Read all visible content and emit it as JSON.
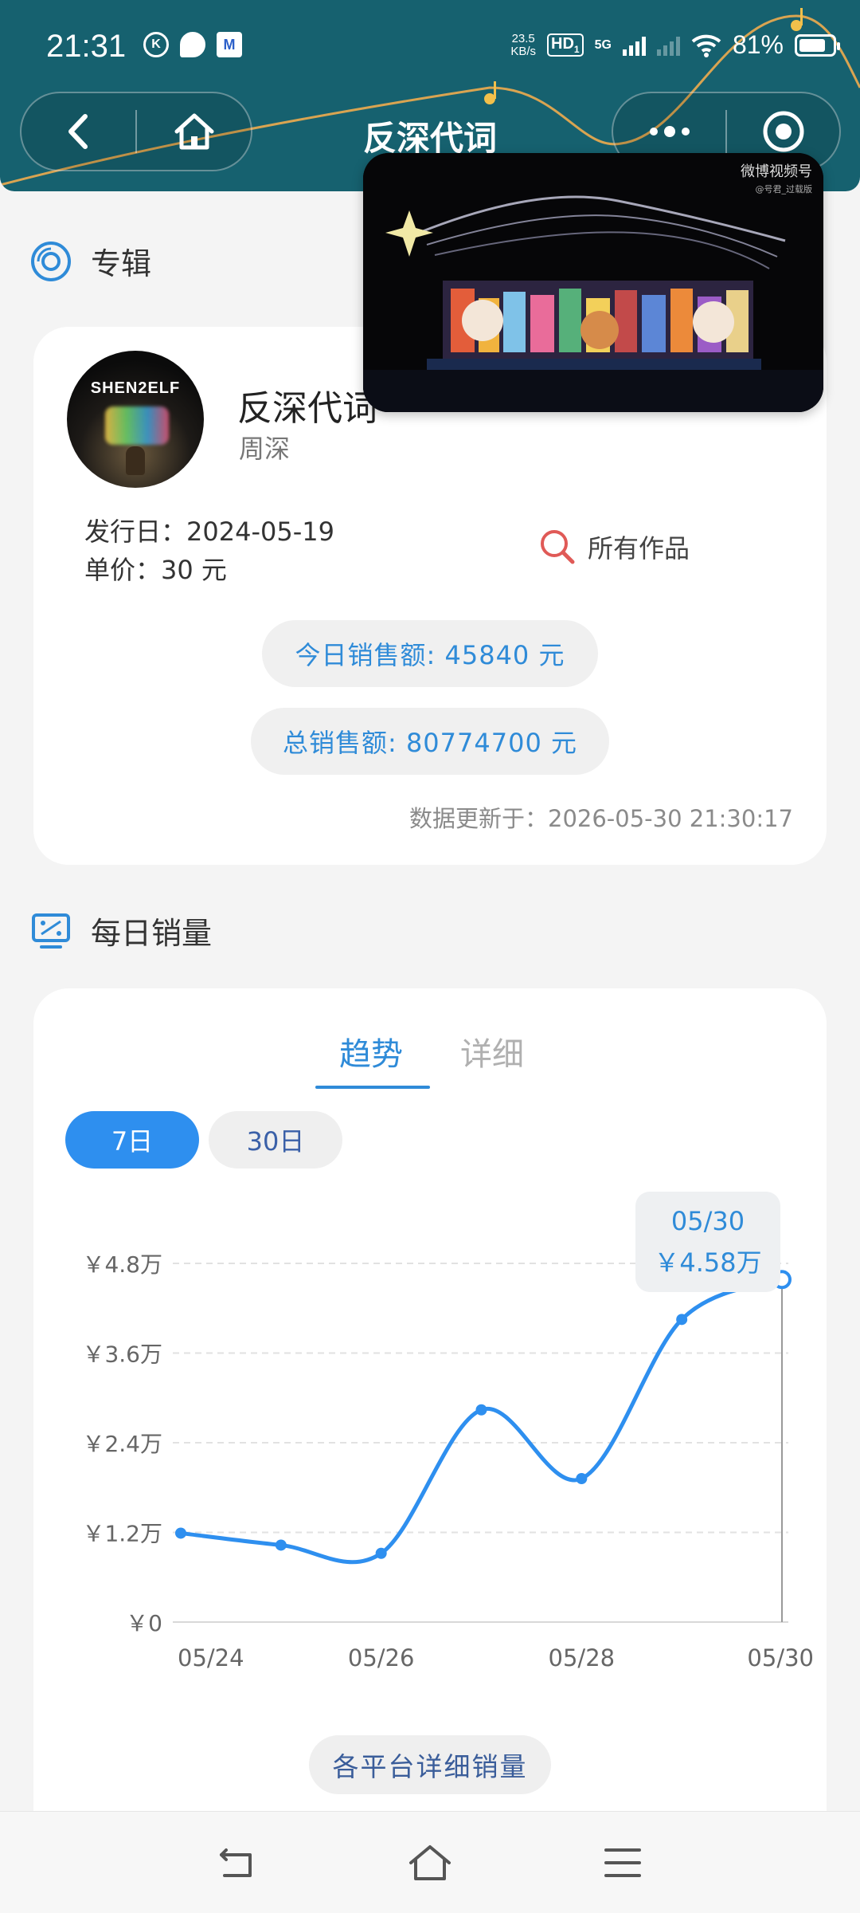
{
  "status_bar": {
    "time": "21:31",
    "net_speed_value": "23.5",
    "net_speed_unit": "KB/s",
    "hd_label": "HD",
    "hd_sub": "1",
    "network": "5G",
    "battery_percent": "81%",
    "battery_level": 0.81
  },
  "header": {
    "title": "反深代词"
  },
  "album_section": {
    "label": "专辑",
    "cover_text": "SHEN2ELF",
    "album_title": "反深代词",
    "artist": "周深",
    "release": "发行日：2024-05-19",
    "price": "单价：30 元",
    "all_works": "所有作品",
    "today_sales": "今日销售额: 45840 元",
    "total_sales": "总销售额: 80774700 元",
    "updated": "数据更新于：2026-05-30 21:30:17"
  },
  "video": {
    "watermark": "微博视频号",
    "watermark_sub": "@号君_过载版"
  },
  "daily_section": {
    "label": "每日销量",
    "tabs": [
      "趋势",
      "详细"
    ],
    "ranges": [
      "7日",
      "30日"
    ],
    "tooltip_date": "05/30",
    "tooltip_value": "￥4.58万",
    "platform_button": "各平台详细销量"
  },
  "colors": {
    "header_bg": "#16616f",
    "accent": "#2f8bd8",
    "active_range": "#2e8fef",
    "line": "#2e8fef"
  },
  "chart_data": {
    "type": "line",
    "x": [
      "05/24",
      "05/25",
      "05/26",
      "05/27",
      "05/28",
      "05/29",
      "05/30"
    ],
    "x_tick_labels": [
      "05/24",
      "05/26",
      "05/28",
      "05/30"
    ],
    "series": [
      {
        "values": [
          11900,
          10300,
          9200,
          28400,
          19200,
          40500,
          45840
        ]
      }
    ],
    "y_ticks": [
      0,
      12000,
      24000,
      36000,
      48000
    ],
    "y_tick_labels": [
      "￥0",
      "￥1.2万",
      "￥2.4万",
      "￥3.6万",
      "￥4.8万"
    ],
    "ylim": [
      0,
      48000
    ],
    "grid": true,
    "smooth": true
  }
}
